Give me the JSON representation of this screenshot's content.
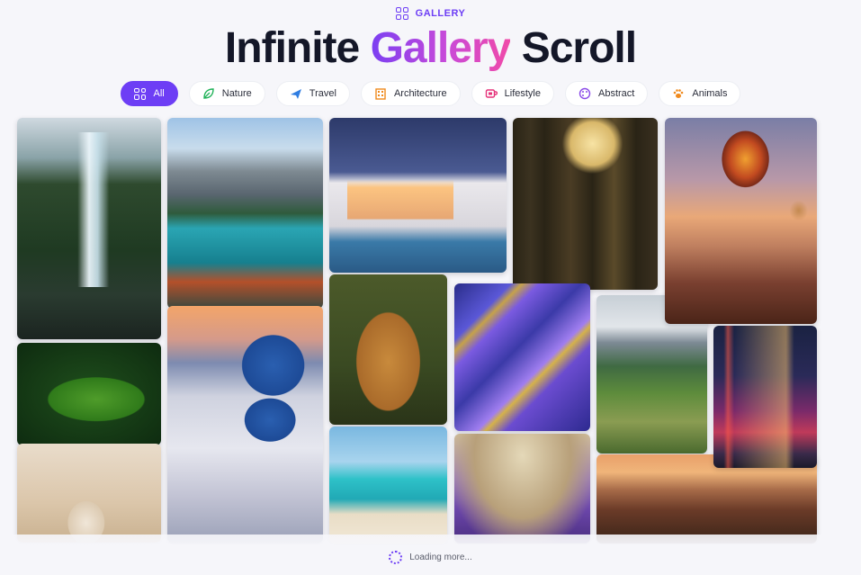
{
  "header": {
    "eyebrow": "GALLERY",
    "title_before": "Infinite ",
    "title_accent": "Gallery",
    "title_after": " Scroll"
  },
  "filters": [
    {
      "label": "All",
      "icon": "grid-icon",
      "active": true
    },
    {
      "label": "Nature",
      "icon": "leaf-icon",
      "active": false
    },
    {
      "label": "Travel",
      "icon": "plane-icon",
      "active": false
    },
    {
      "label": "Architecture",
      "icon": "building-icon",
      "active": false
    },
    {
      "label": "Lifestyle",
      "icon": "coffee-icon",
      "active": false
    },
    {
      "label": "Abstract",
      "icon": "palette-icon",
      "active": false
    },
    {
      "label": "Animals",
      "icon": "paw-icon",
      "active": false
    }
  ],
  "status": {
    "loading_text": "Loading more..."
  },
  "colors": {
    "accent": "#6d3ef5",
    "accent_pink": "#f04aa8"
  },
  "tiles": [
    "waterfall",
    "leaf",
    "vase",
    "mountain-lake",
    "santorini",
    "modern-house",
    "golden-retriever",
    "beach",
    "forest-path",
    "purple-marble",
    "lavender",
    "green-hill-trail",
    "hot-air-balloons",
    "city-night",
    "canyon-sunset"
  ]
}
